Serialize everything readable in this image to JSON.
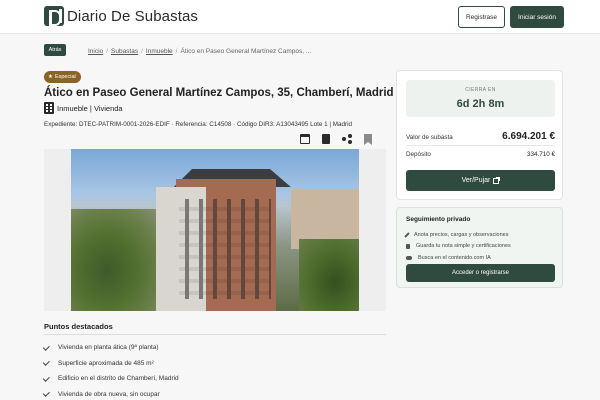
{
  "header": {
    "logo_text": "Diario De Subastas",
    "register_label": "Registrase",
    "login_label": "Iniciar sesión"
  },
  "nav": {
    "back_label": "Atrás",
    "breadcrumb": [
      "Inicio",
      "Subastas",
      "Inmueble",
      "Ático en Paseo General Martínez Campos, ..."
    ]
  },
  "listing": {
    "badge": "Especial",
    "title": "Ático en Paseo General Martínez Campos, 35, Chamberí, Madrid",
    "category": "Inmueble | Vivienda",
    "meta": "Expediente: DTEC-PATRIM-0001-2026-EDIF · Referencia: C14508 · Código DIR3: A13043495 Lote 1 | Madrid",
    "actions": [
      "calendar-add-icon",
      "clipboard-icon",
      "share-icon",
      "bookmark-icon"
    ]
  },
  "highlights": {
    "title": "Puntos destacados",
    "items": [
      "Vivienda en planta ática (9ª planta)",
      "Superficie aproximada de 485 m²",
      "Edificio en el distrito de Chamberí, Madrid",
      "Vivienda de obra nueva, sin ocupar"
    ]
  },
  "auction_card": {
    "countdown_label": "CIERRA EN",
    "countdown_value": "6d 2h 8m",
    "auction_value_label": "Valor de subasta",
    "auction_value": "6.694.201 €",
    "deposit_label": "Depósito",
    "deposit_value": "334.710 €",
    "bid_button": "Ver/Pujar"
  },
  "follow_card": {
    "title": "Seguimiento privado",
    "items": [
      "Anota precios, cargas y observaciones",
      "Guarda tu nota simple y certificaciones",
      "Busca en el contenido.com IA"
    ],
    "button": "Acceder o registrarse"
  },
  "colors": {
    "primary": "#2f4a3e",
    "badge": "#8a6424",
    "background": "#f6f7f6"
  }
}
